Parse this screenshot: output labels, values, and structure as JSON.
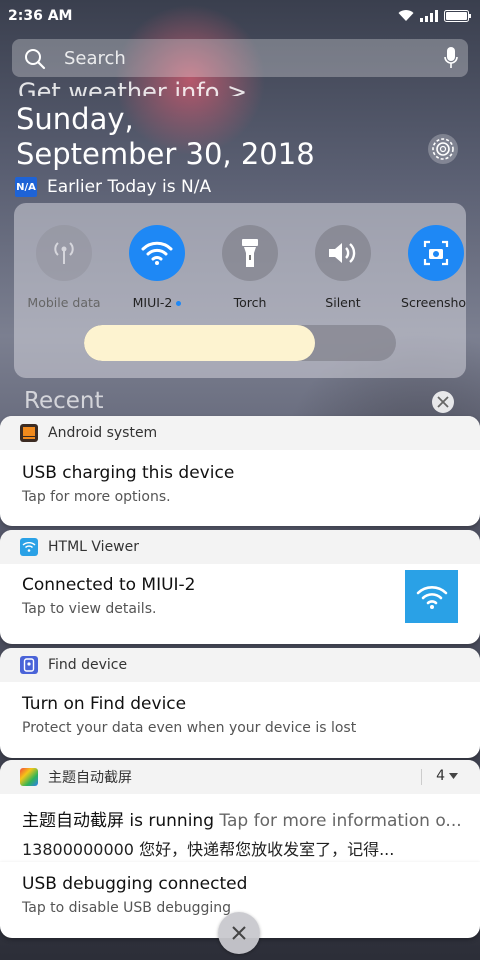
{
  "status_bar": {
    "time": "2:36 AM"
  },
  "search": {
    "placeholder": "Search"
  },
  "weather_cut": "Get weather info >",
  "date": {
    "line1": "Sunday,",
    "line2": "September 30, 2018"
  },
  "weather": {
    "badge": "N/A",
    "text": "Earlier Today is N/A"
  },
  "quick_settings": {
    "tiles": [
      {
        "label": "Mobile data",
        "state": "disabled"
      },
      {
        "label": "MIUI-2",
        "state": "on"
      },
      {
        "label": "Torch",
        "state": "off"
      },
      {
        "label": "Silent",
        "state": "off"
      },
      {
        "label": "Screenshot",
        "state": "on"
      }
    ],
    "brightness_level": 0.74
  },
  "recent_label": "Recent",
  "notifications": [
    {
      "app": "Android system",
      "title": "USB charging this device",
      "sub": "Tap for more options."
    },
    {
      "app": "HTML Viewer",
      "title": "Connected to MIUI-2",
      "sub": "Tap to view details."
    },
    {
      "app": "Find device",
      "title": "Turn on Find device",
      "sub": "Protect your data even when your device is lost"
    },
    {
      "app": "主题自动截屏",
      "count": "4",
      "title_bold": "主题自动截屏 is running",
      "title_rest": "Tap for more information o...",
      "sub": "13800000000 您好，快递帮您放收发室了，记得..."
    },
    {
      "title": "USB debugging connected",
      "sub": "Tap to disable USB debugging"
    }
  ],
  "colors": {
    "accent": "#1e88f5",
    "card_bg": "#ffffff",
    "header_bg": "#f3f3f3"
  }
}
